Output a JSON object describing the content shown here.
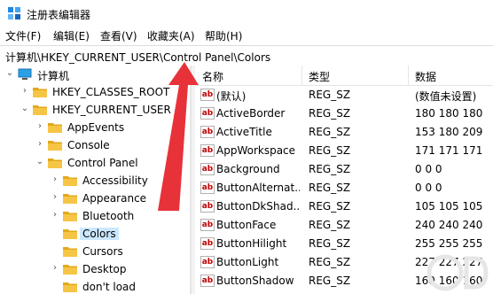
{
  "window": {
    "title": "注册表编辑器"
  },
  "menu": [
    "文件(F)",
    "编辑(E)",
    "查看(V)",
    "收藏夹(A)",
    "帮助(H)"
  ],
  "address": "计算机\\HKEY_CURRENT_USER\\Control Panel\\Colors",
  "tree": [
    {
      "label": "计算机",
      "icon": "computer-icon",
      "chevron": "expanded"
    },
    {
      "label": "HKEY_CLASSES_ROOT",
      "icon": "folder-icon",
      "chevron": "collapsed"
    },
    {
      "label": "HKEY_CURRENT_USER",
      "icon": "folder-icon",
      "chevron": "expanded"
    },
    {
      "label": "AppEvents",
      "icon": "folder-icon",
      "chevron": "collapsed"
    },
    {
      "label": "Console",
      "icon": "folder-icon",
      "chevron": "collapsed"
    },
    {
      "label": "Control Panel",
      "icon": "folder-icon",
      "chevron": "expanded"
    },
    {
      "label": "Accessibility",
      "icon": "folder-icon",
      "chevron": "collapsed"
    },
    {
      "label": "Appearance",
      "icon": "folder-icon",
      "chevron": "collapsed"
    },
    {
      "label": "Bluetooth",
      "icon": "folder-icon",
      "chevron": "collapsed"
    },
    {
      "label": "Colors",
      "icon": "folder-icon",
      "chevron": "none",
      "selected": true
    },
    {
      "label": "Cursors",
      "icon": "folder-icon",
      "chevron": "none"
    },
    {
      "label": "Desktop",
      "icon": "folder-icon",
      "chevron": "collapsed"
    },
    {
      "label": "don't load",
      "icon": "folder-icon",
      "chevron": "none"
    }
  ],
  "columns": {
    "name": "名称",
    "type": "类型",
    "data": "数据"
  },
  "values": [
    {
      "name": "(默认)",
      "type": "REG_SZ",
      "data": "(数值未设置)"
    },
    {
      "name": "ActiveBorder",
      "type": "REG_SZ",
      "data": "180 180 180"
    },
    {
      "name": "ActiveTitle",
      "type": "REG_SZ",
      "data": "153 180 209"
    },
    {
      "name": "AppWorkspace",
      "type": "REG_SZ",
      "data": "171 171 171"
    },
    {
      "name": "Background",
      "type": "REG_SZ",
      "data": "0 0 0"
    },
    {
      "name": "ButtonAlternat...",
      "type": "REG_SZ",
      "data": "0 0 0"
    },
    {
      "name": "ButtonDkShad...",
      "type": "REG_SZ",
      "data": "105 105 105"
    },
    {
      "name": "ButtonFace",
      "type": "REG_SZ",
      "data": "240 240 240"
    },
    {
      "name": "ButtonHilight",
      "type": "REG_SZ",
      "data": "255 255 255"
    },
    {
      "name": "ButtonLight",
      "type": "REG_SZ",
      "data": "227 227 227"
    },
    {
      "name": "ButtonShadow",
      "type": "REG_SZ",
      "data": "160 160 160"
    }
  ],
  "colors": {
    "folder": "#f6c545",
    "folder_dark": "#e3a81b",
    "arrow": "#e8323a",
    "selected": "#cce8ff"
  }
}
